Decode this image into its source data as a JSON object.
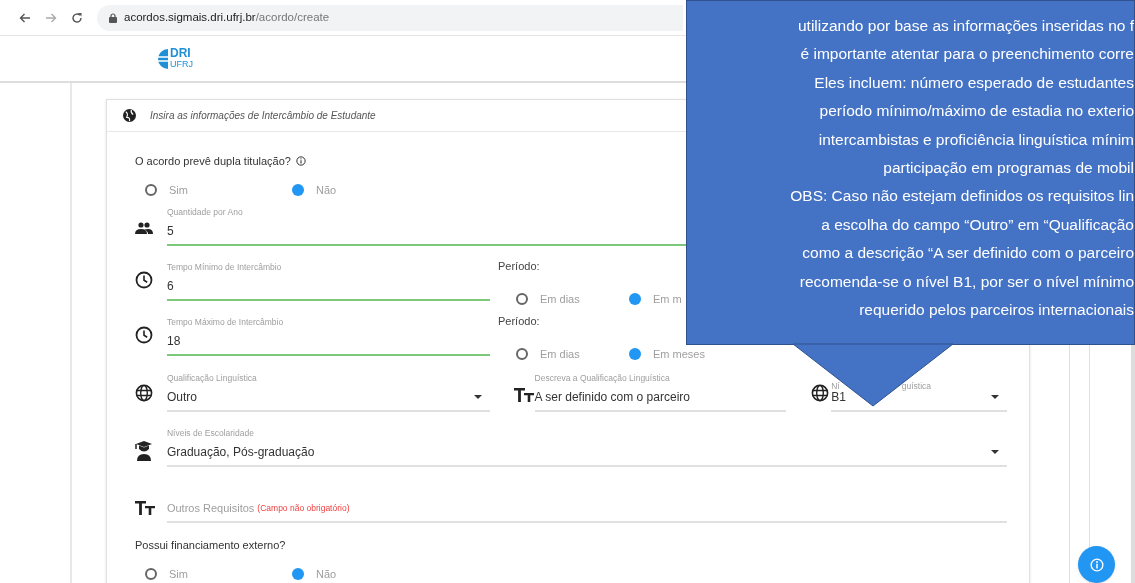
{
  "browser": {
    "url_host": "acordos.sigmais.dri.ufrj.br",
    "url_path": "/acordo/create"
  },
  "logo": {
    "title": "DRI",
    "subtitle": "UFRJ"
  },
  "card": {
    "title": "Insira as informações de Intercâmbio de Estudante"
  },
  "double_degree": {
    "question": "O acordo prevê dupla titulação?",
    "options": [
      {
        "label": "Sim",
        "selected": false
      },
      {
        "label": "Não",
        "selected": true
      }
    ]
  },
  "quantity": {
    "label": "Quantidade por Ano",
    "value": "5"
  },
  "min_time": {
    "label": "Tempo Mínimo de Intercâmbio",
    "value": "6",
    "period_label": "Período:",
    "options": [
      {
        "label": "Em dias",
        "selected": false
      },
      {
        "label": "Em m",
        "selected": true
      }
    ]
  },
  "max_time": {
    "label": "Tempo Máximo de Intercâmbio",
    "value": "18",
    "period_label": "Período:",
    "options": [
      {
        "label": "Em dias",
        "selected": false
      },
      {
        "label": "Em meses",
        "selected": true
      }
    ]
  },
  "language": {
    "label": "Qualificação Linguística",
    "value": "Outro"
  },
  "language_description": {
    "label": "Descreva a Qualificação Linguística",
    "value": "A ser definido com o parceiro"
  },
  "language_level": {
    "label_parts": [
      "Ní",
      "guística"
    ],
    "value": "B1"
  },
  "education": {
    "label": "Níveis de Escolaridade",
    "value": "Graduação, Pós-graduação"
  },
  "other_requirements": {
    "placeholder": "Outros Requisitos",
    "note": "(Campo não obrigatório)"
  },
  "financing": {
    "question": "Possui financiamento externo?",
    "options": [
      {
        "label": "Sim",
        "selected": false
      },
      {
        "label": "Não",
        "selected": true
      }
    ]
  },
  "callout": {
    "lines": [
      "utilizando por base as informações inseridas no f",
      "é importante atentar para o preenchimento corre",
      "Eles incluem: número esperado de estudantes",
      "período mínimo/máximo de estadia no exterio",
      "intercambistas e proficiência linguística mínim",
      "participação em programas de mobil",
      "OBS: Caso não estejam definidos os requisitos lin",
      "a escolha do campo “Outro” em “Qualificação",
      "como a descrição “A ser definido com o parceiro",
      "recomenda-se o nível B1, por ser o nível mínimo",
      "requerido pelos parceiros internacionais"
    ]
  }
}
